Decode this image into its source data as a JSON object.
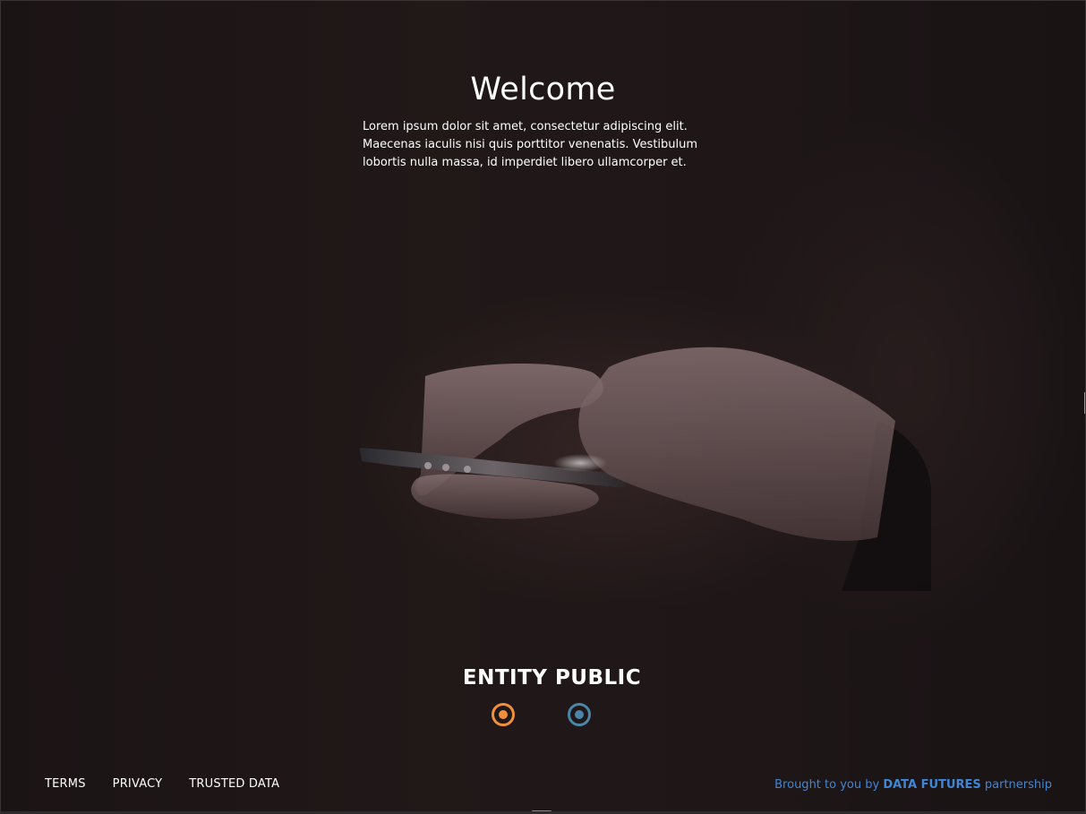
{
  "hero": {
    "title": "Welcome",
    "body": "Lorem ipsum dolor sit amet, consectetur adipiscing elit. Maecenas iaculis nisi quis porttitor venenatis. Vestibulum lobortis nulla massa, id imperdiet libero ullamcorper et."
  },
  "entity": {
    "title": "ENTITY PUBLIC",
    "options": [
      {
        "name": "option-orange",
        "color": "#f0913a"
      },
      {
        "name": "option-blue",
        "color": "#4a86a8"
      }
    ]
  },
  "footer": {
    "links": [
      "TERMS",
      "PRIVACY",
      "TRUSTED DATA"
    ],
    "credit_prefix": "Brought to you by",
    "credit_brand": "DATA FUTURES",
    "credit_suffix": "partnership",
    "credit_color": "#3f86d6"
  },
  "background": {
    "image": "hands-holding-smartphone-photo"
  }
}
